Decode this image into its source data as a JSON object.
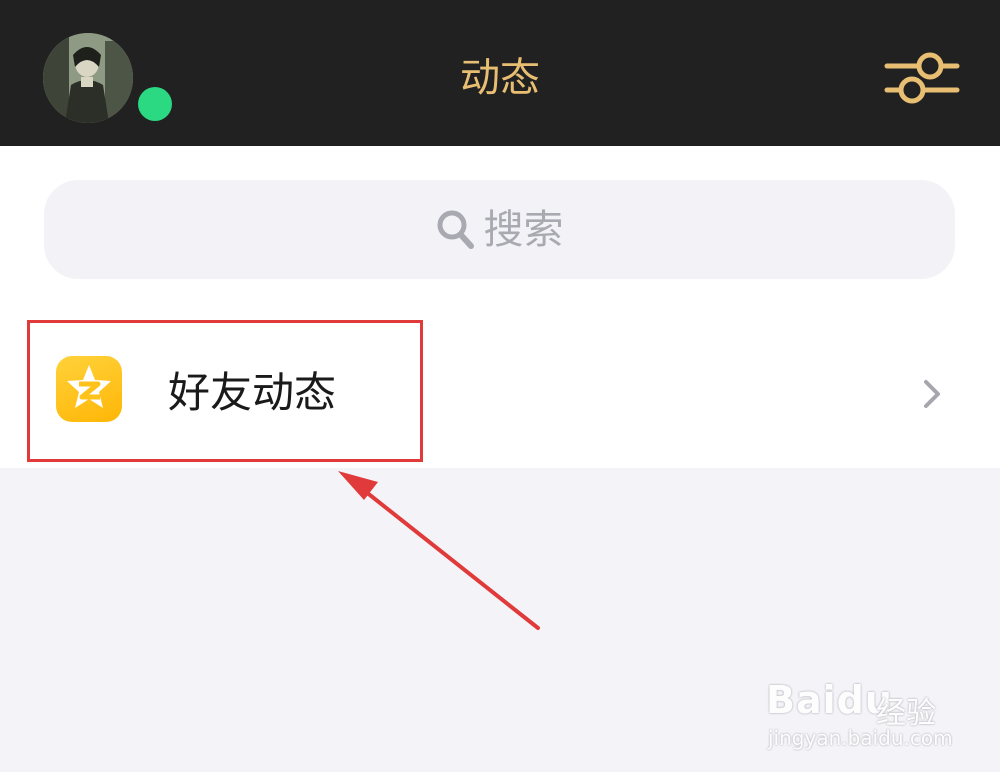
{
  "header": {
    "title": "动态",
    "avatar_icon": "user-avatar",
    "status": "online",
    "status_color": "#2bd982",
    "settings_icon": "sliders-icon",
    "background_color": "#212121",
    "accent_color": "#e8bf72"
  },
  "search": {
    "placeholder": "搜索",
    "icon": "search-icon"
  },
  "list": {
    "items": [
      {
        "label": "好友动态",
        "icon": "qzone-star-icon",
        "trailing_icon": "chevron-right-icon"
      }
    ]
  },
  "annotation": {
    "highlight_color": "#e03a3a",
    "arrow_color": "#e03a3a"
  },
  "watermark": {
    "brand": "Baidu",
    "sub": "经验",
    "url": "jingyan.baidu.com"
  }
}
